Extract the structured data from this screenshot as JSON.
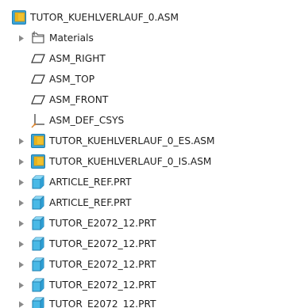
{
  "model_tree": {
    "root": {
      "label": "TUTOR_KUEHLVERLAUF_0.ASM",
      "icon": "assembly-icon",
      "expanded": true
    },
    "items": [
      {
        "label": "Materials",
        "icon": "materials-folder-icon",
        "expandable": true
      },
      {
        "label": "ASM_RIGHT",
        "icon": "datum-plane-icon",
        "expandable": false
      },
      {
        "label": "ASM_TOP",
        "icon": "datum-plane-icon",
        "expandable": false
      },
      {
        "label": "ASM_FRONT",
        "icon": "datum-plane-icon",
        "expandable": false
      },
      {
        "label": "ASM_DEF_CSYS",
        "icon": "coordinate-system-icon",
        "expandable": false
      },
      {
        "label": "TUTOR_KUEHLVERLAUF_0_ES.ASM",
        "icon": "assembly-icon",
        "expandable": true
      },
      {
        "label": "TUTOR_KUEHLVERLAUF_0_IS.ASM",
        "icon": "assembly-icon",
        "expandable": true
      },
      {
        "label": "ARTICLE_REF.PRT",
        "icon": "part-icon",
        "expandable": true
      },
      {
        "label": "ARTICLE_REF.PRT",
        "icon": "part-icon",
        "expandable": true
      },
      {
        "label": "TUTOR_E2072_12.PRT",
        "icon": "part-icon",
        "expandable": true
      },
      {
        "label": "TUTOR_E2072_12.PRT",
        "icon": "part-icon",
        "expandable": true
      },
      {
        "label": "TUTOR_E2072_12.PRT",
        "icon": "part-icon",
        "expandable": true
      },
      {
        "label": "TUTOR_E2072_12.PRT",
        "icon": "part-icon",
        "expandable": true
      },
      {
        "label": "TUTOR_E2072_12.PRT",
        "icon": "part-icon",
        "expandable": true
      }
    ]
  },
  "colors": {
    "text": "#1e1e1e",
    "assembly_blue": "#3aa4d8",
    "assembly_yellow": "#f2c12e",
    "part_cyan": "#49b9e6",
    "datum_line": "#333333",
    "csys_orange": "#d9822b",
    "twisty": "#8a8a8a"
  }
}
